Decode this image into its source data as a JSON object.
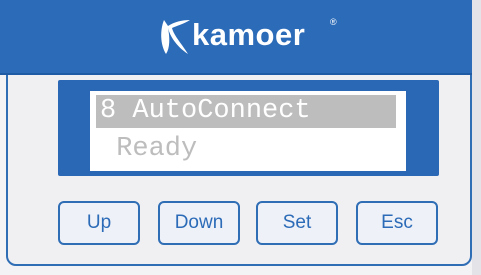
{
  "brand": {
    "name": "Kamoer",
    "logo_text": "kamoer",
    "registered_mark": "®"
  },
  "display": {
    "line1": "8 AutoConnect",
    "line2": " Ready"
  },
  "buttons": {
    "up": "Up",
    "down": "Down",
    "set": "Set",
    "esc": "Esc"
  },
  "colors": {
    "panel_blue": "#2c6bb8",
    "lcd_highlight": "#bdbdbd",
    "lcd_text": "#ffffff"
  }
}
